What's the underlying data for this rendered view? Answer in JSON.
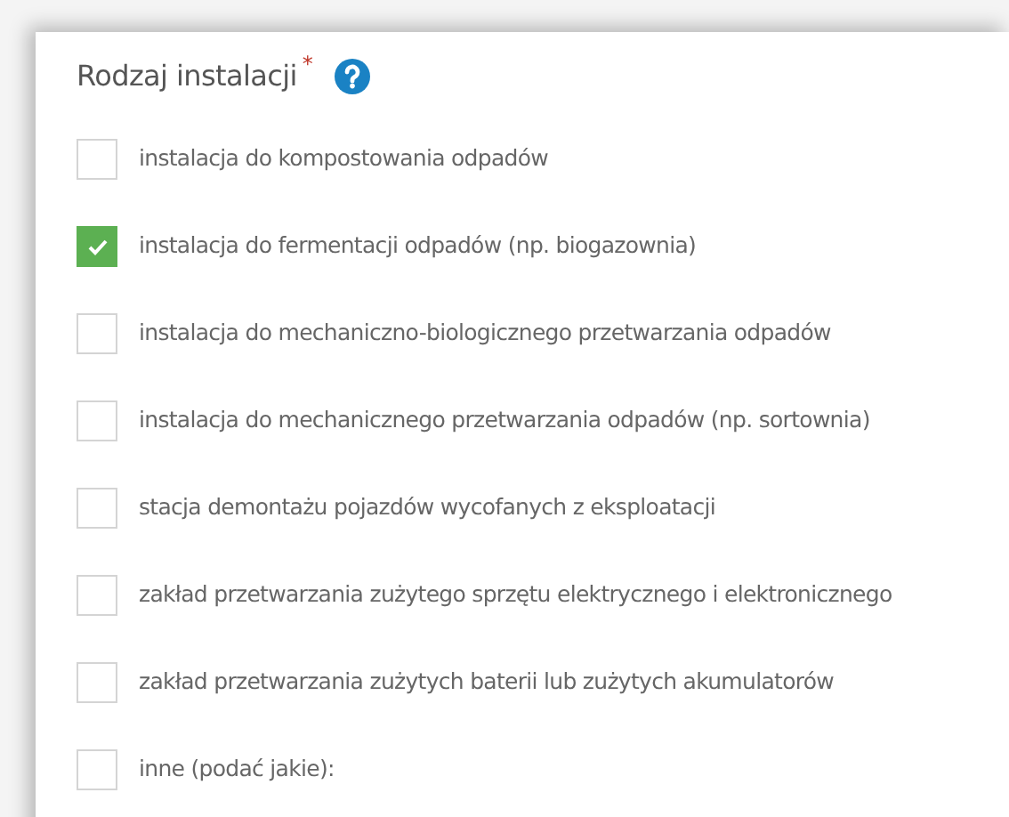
{
  "field": {
    "label": "Rodzaj instalacji",
    "required_mark": "*",
    "options": [
      {
        "label": "instalacja do kompostowania odpadów",
        "checked": false
      },
      {
        "label": "instalacja do fermentacji odpadów (np. biogazownia)",
        "checked": true
      },
      {
        "label": "instalacja do mechaniczno-biologicznego przetwarzania odpadów",
        "checked": false
      },
      {
        "label": "instalacja do mechanicznego przetwarzania odpadów (np. sortownia)",
        "checked": false
      },
      {
        "label": "stacja demontażu pojazdów wycofanych z eksploatacji",
        "checked": false
      },
      {
        "label": "zakład przetwarzania zużytego sprzętu elektrycznego i elektronicznego",
        "checked": false
      },
      {
        "label": "zakład przetwarzania zużytych baterii lub zużytych akumulatorów",
        "checked": false
      },
      {
        "label": "inne (podać jakie):",
        "checked": false
      }
    ]
  }
}
